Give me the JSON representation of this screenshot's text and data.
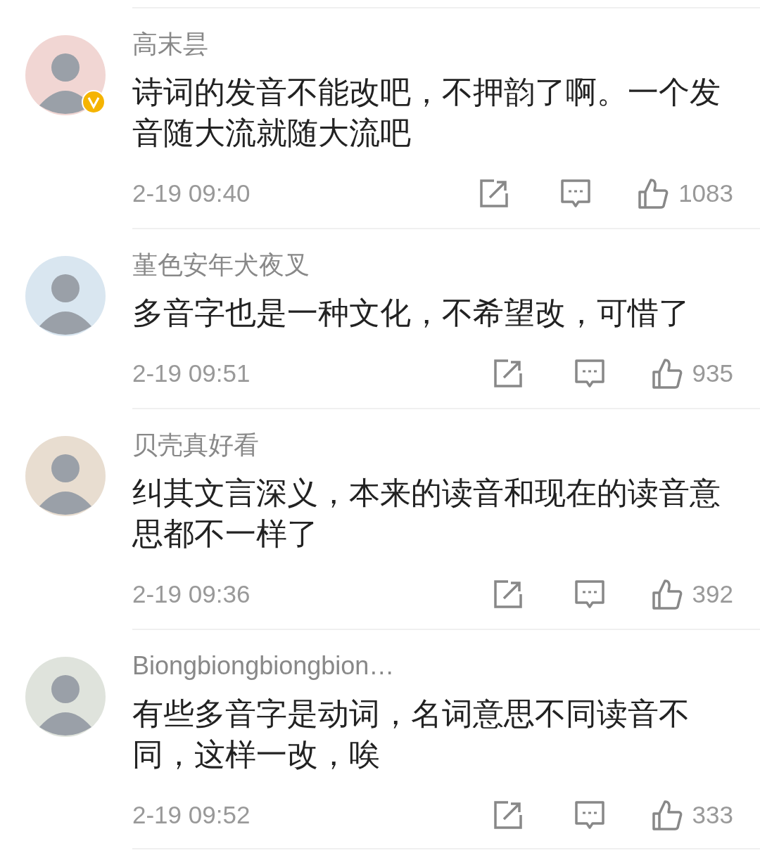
{
  "comments": [
    {
      "user": "高末昙",
      "verified": true,
      "text": "诗词的发音不能改吧，不押韵了啊。一个发音随大流就随大流吧",
      "time": "2-19 09:40",
      "likes": "1083"
    },
    {
      "user": "堇色安年犬夜叉",
      "verified": false,
      "text": "多音字也是一种文化，不希望改，可惜了",
      "time": "2-19 09:51",
      "likes": "935"
    },
    {
      "user": "贝壳真好看",
      "verified": false,
      "text": "纠其文言深义，本来的读音和现在的读音意思都不一样了",
      "time": "2-19 09:36",
      "likes": "392"
    },
    {
      "user": "Biongbiongbiongbion…",
      "verified": false,
      "text": "有些多音字是动词，名词意思不同读音不同，这样一改，唉",
      "time": "2-19 09:52",
      "likes": "333"
    }
  ]
}
